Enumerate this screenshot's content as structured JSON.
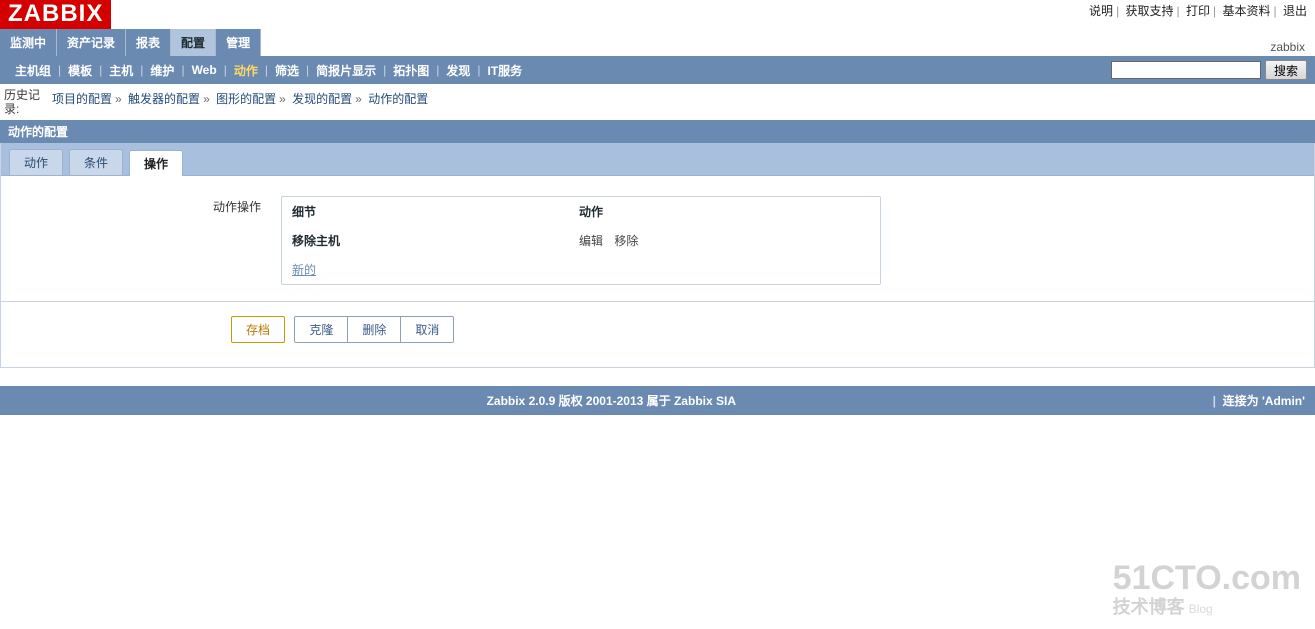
{
  "logo_text": "ZABBIX",
  "top_links": {
    "help": "说明",
    "support": "获取支持",
    "print": "打印",
    "profile": "基本资料",
    "logout": "退出"
  },
  "main_tabs": [
    {
      "key": "monitoring",
      "label": "监测中"
    },
    {
      "key": "inventory",
      "label": "资产记录"
    },
    {
      "key": "reports",
      "label": "报表"
    },
    {
      "key": "configuration",
      "label": "配置",
      "active": true
    },
    {
      "key": "admin",
      "label": "管理"
    }
  ],
  "user_label": "zabbix",
  "sub_tabs": [
    {
      "key": "hostgroups",
      "label": "主机组"
    },
    {
      "key": "templates",
      "label": "模板"
    },
    {
      "key": "hosts",
      "label": "主机"
    },
    {
      "key": "maintenance",
      "label": "维护"
    },
    {
      "key": "web",
      "label": "Web"
    },
    {
      "key": "actions",
      "label": "动作",
      "active": true
    },
    {
      "key": "screens",
      "label": "筛选"
    },
    {
      "key": "slideshows",
      "label": "简报片显示"
    },
    {
      "key": "maps",
      "label": "拓扑图"
    },
    {
      "key": "discovery",
      "label": "发现"
    },
    {
      "key": "itservices",
      "label": "IT服务"
    }
  ],
  "search_button": "搜索",
  "history": {
    "label": "历史记录:",
    "items": [
      "项目的配置",
      "触发器的配置",
      "图形的配置",
      "发现的配置",
      "动作的配置"
    ]
  },
  "section_title": "动作的配置",
  "inner_tabs": [
    {
      "key": "action",
      "label": "动作"
    },
    {
      "key": "conditions",
      "label": "条件"
    },
    {
      "key": "operations",
      "label": "操作",
      "active": true
    }
  ],
  "ops": {
    "row_label": "动作操作",
    "col_detail": "细节",
    "col_action": "动作",
    "row_detail": "移除主机",
    "edit": "编辑",
    "remove": "移除",
    "new": "新的"
  },
  "buttons": {
    "save": "存档",
    "clone": "克隆",
    "delete": "删除",
    "cancel": "取消"
  },
  "footer": {
    "copyright": "Zabbix 2.0.9 版权 2001-2013 属于 Zabbix SIA",
    "connected_as_prefix": "连接为",
    "connected_as_user": "'Admin'"
  },
  "watermark": {
    "line1": "51CTO.com",
    "line2": "技术博客",
    "badge": "Blog"
  }
}
